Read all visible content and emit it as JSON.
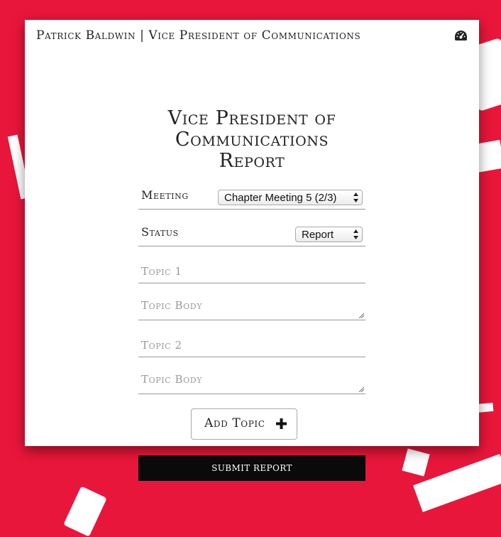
{
  "header": {
    "title": "Patrick Baldwin | Vice President of Communications",
    "icon": "dashboard-gauge-icon"
  },
  "form": {
    "title_line1": "Vice President of",
    "title_line2": "Communications",
    "title_line3": "Report",
    "meeting": {
      "label": "Meeting",
      "selected": "Chapter Meeting 5 (2/3)"
    },
    "status": {
      "label": "Status",
      "selected": "Report"
    },
    "topics": [
      {
        "title_placeholder": "Topic 1",
        "body_placeholder": "Topic Body"
      },
      {
        "title_placeholder": "Topic 2",
        "body_placeholder": "Topic Body"
      }
    ],
    "add_topic_label": "Add Topic",
    "submit_label": "SUBMIT REPORT"
  },
  "colors": {
    "background": "#e8163a",
    "card": "#ffffff",
    "submit_bg": "#0a0a0a"
  }
}
